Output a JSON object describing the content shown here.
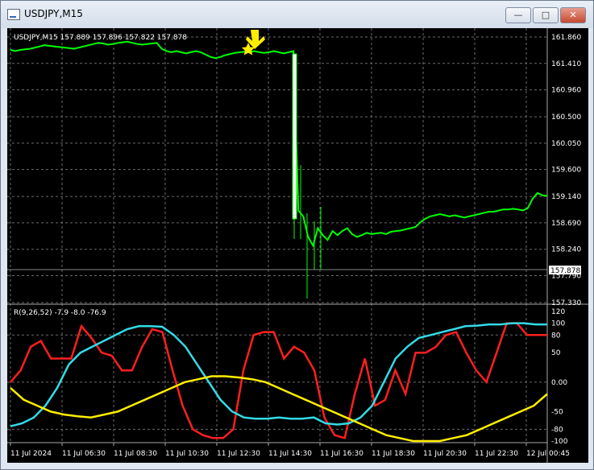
{
  "window": {
    "title": "USDJPY,M15",
    "minimize_label": "—",
    "maximize_label": "□",
    "close_label": "✕"
  },
  "price_panel": {
    "header": "USDJPY,M15  157.889 157.896 157.822 157.878",
    "current_price_label": "157.878",
    "y_ticks": [
      "161.860",
      "161.410",
      "160.960",
      "160.500",
      "160.050",
      "159.600",
      "159.140",
      "158.690",
      "158.240",
      "157.790",
      "157.330"
    ],
    "marker_icons": [
      "arrow-down-icon",
      "star-icon"
    ]
  },
  "indicator_panel": {
    "header": "R(9,26,52) -7.9 -8.0 -76.9",
    "y_ticks": [
      "120",
      "100",
      "80",
      "50",
      "0.00",
      "-50",
      "-80",
      "-100"
    ]
  },
  "x_axis": {
    "labels": [
      "11 Jul 2024",
      "11 Jul 06:30",
      "11 Jul 08:30",
      "11 Jul 10:30",
      "11 Jul 12:30",
      "11 Jul 14:30",
      "11 Jul 16:30",
      "11 Jul 18:30",
      "11 Jul 20:30",
      "11 Jul 22:30",
      "12 Jul 00:45"
    ]
  },
  "colors": {
    "background": "#000000",
    "grid": "#6b6b6b",
    "candle": "#00ff00",
    "axis_text": "#ffffff",
    "line_red": "#ff1f1f",
    "line_cyan": "#33dbe6",
    "line_yellow": "#ffee00",
    "marker": "#ffee00"
  },
  "chart_data": [
    {
      "type": "line",
      "title": "USDJPY,M15",
      "description_values": "close prices, approximate",
      "series": [
        {
          "name": "USDJPY",
          "values": [
            161.64,
            161.62,
            161.64,
            161.65,
            161.66,
            161.68,
            161.7,
            161.72,
            161.71,
            161.7,
            161.69,
            161.68,
            161.67,
            161.66,
            161.68,
            161.7,
            161.72,
            161.74,
            161.76,
            161.75,
            161.73,
            161.74,
            161.76,
            161.77,
            161.78,
            161.76,
            161.74,
            161.73,
            161.74,
            161.75,
            161.76,
            161.66,
            161.62,
            161.6,
            161.62,
            161.6,
            161.58,
            161.6,
            161.62,
            161.6,
            161.56,
            161.52,
            161.5,
            161.52,
            161.55,
            161.57,
            161.59,
            161.6,
            161.61,
            161.6,
            161.62,
            161.6,
            161.59,
            161.6,
            161.62,
            161.6,
            161.58,
            161.6,
            161.62,
            158.9,
            158.8,
            158.45,
            158.3,
            158.6,
            158.48,
            158.4,
            158.55,
            158.48,
            158.55,
            158.6,
            158.5,
            158.45,
            158.48,
            158.52,
            158.5,
            158.51,
            158.52,
            158.5,
            158.54,
            158.55,
            158.56,
            158.58,
            158.6,
            158.62,
            158.7,
            158.76,
            158.8,
            158.82,
            158.84,
            158.82,
            158.8,
            158.82,
            158.8,
            158.78,
            158.8,
            158.82,
            158.84,
            158.86,
            158.88,
            158.88,
            158.9,
            158.92,
            158.92,
            158.93,
            158.92,
            158.9,
            158.94,
            159.1,
            159.2,
            159.16,
            159.15
          ]
        }
      ],
      "ylim": [
        157.33,
        161.86
      ]
    },
    {
      "type": "line",
      "title": "",
      "series": [
        {
          "name": "",
          "values": [
            0,
            20,
            60,
            70,
            40,
            40,
            40,
            95,
            75,
            50,
            45,
            20,
            20,
            60,
            90,
            85,
            20,
            -40,
            -80,
            -90,
            -95,
            -95,
            -80,
            20,
            80,
            85,
            85,
            40,
            60,
            50,
            20,
            -60,
            -90,
            -95,
            -20,
            40,
            -40,
            -30,
            20,
            -20,
            50,
            50,
            60,
            80,
            85,
            50,
            20,
            0,
            50,
            100,
            100,
            80,
            80,
            80
          ]
        },
        {
          "name": "",
          "values": [
            -75,
            -70,
            -60,
            -40,
            -10,
            30,
            50,
            60,
            70,
            80,
            90,
            95,
            95,
            94,
            80,
            60,
            30,
            0,
            -30,
            -50,
            -60,
            -62,
            -62,
            -60,
            -62,
            -62,
            -60,
            -70,
            -72,
            -70,
            -60,
            -40,
            0,
            40,
            60,
            75,
            80,
            85,
            90,
            95,
            96,
            98,
            98,
            100,
            100,
            98,
            98
          ]
        },
        {
          "name": "",
          "values": [
            -10,
            -30,
            -40,
            -50,
            -55,
            -58,
            -60,
            -55,
            -50,
            -40,
            -30,
            -20,
            -10,
            0,
            5,
            10,
            10,
            8,
            5,
            0,
            -10,
            -20,
            -30,
            -40,
            -50,
            -60,
            -70,
            -80,
            -90,
            -95,
            -100,
            -100,
            -100,
            -95,
            -90,
            -80,
            -70,
            -60,
            -50,
            -40,
            -20
          ]
        }
      ],
      "ylim": [
        -100,
        120
      ]
    }
  ]
}
